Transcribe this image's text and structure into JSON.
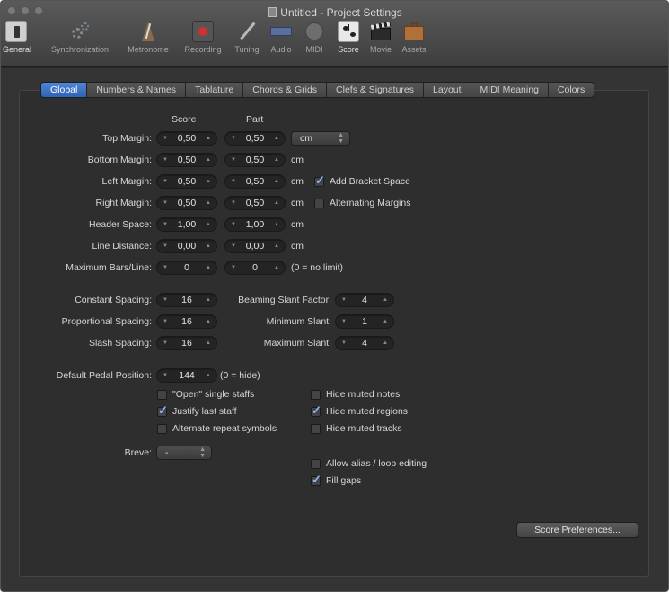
{
  "window": {
    "title": "Untitled - Project Settings"
  },
  "toolbar": [
    {
      "label": "General",
      "icon": "general-icon",
      "color": "#cfcfcf"
    },
    {
      "label": "Synchronization",
      "icon": "synchronization-icon",
      "color": "#7d8b97"
    },
    {
      "label": "Metronome",
      "icon": "metronome-icon",
      "color": "#8a6a4a"
    },
    {
      "label": "Recording",
      "icon": "recording-icon",
      "color": "#c03030"
    },
    {
      "label": "Tuning",
      "icon": "tuning-fork-icon",
      "color": "#b8b8b8"
    },
    {
      "label": "Audio",
      "icon": "audio-icon",
      "color": "#5a6f9a"
    },
    {
      "label": "MIDI",
      "icon": "midi-icon",
      "color": "#777777"
    },
    {
      "label": "Score",
      "icon": "score-icon",
      "color": "#e8e8e8"
    },
    {
      "label": "Movie",
      "icon": "movie-icon",
      "color": "#3a3a3a"
    },
    {
      "label": "Assets",
      "icon": "assets-icon",
      "color": "#b0703a"
    }
  ],
  "tabs": [
    "Global",
    "Numbers & Names",
    "Tablature",
    "Chords & Grids",
    "Clefs & Signatures",
    "Layout",
    "MIDI Meaning",
    "Colors"
  ],
  "columns": {
    "score": "Score",
    "part": "Part"
  },
  "margins": {
    "top": {
      "label": "Top Margin:",
      "score": "0,50",
      "part": "0,50"
    },
    "bottom": {
      "label": "Bottom Margin:",
      "score": "0,50",
      "part": "0,50",
      "unit": "cm"
    },
    "left": {
      "label": "Left Margin:",
      "score": "0,50",
      "part": "0,50",
      "unit": "cm"
    },
    "right": {
      "label": "Right Margin:",
      "score": "0,50",
      "part": "0,50",
      "unit": "cm"
    },
    "header": {
      "label": "Header Space:",
      "score": "1,00",
      "part": "1,00",
      "unit": "cm"
    },
    "line": {
      "label": "Line Distance:",
      "score": "0,00",
      "part": "0,00",
      "unit": "cm"
    },
    "maxbars": {
      "label": "Maximum Bars/Line:",
      "score": "0",
      "part": "0",
      "note": "(0 = no limit)"
    }
  },
  "unit_popup": "cm",
  "add_bracket_space": {
    "label": "Add Bracket Space",
    "checked": true
  },
  "alternating_margins": {
    "label": "Alternating Margins",
    "checked": false
  },
  "spacing": {
    "constant": {
      "label": "Constant Spacing:",
      "value": "16"
    },
    "proportional": {
      "label": "Proportional Spacing:",
      "value": "16"
    },
    "slash": {
      "label": "Slash Spacing:",
      "value": "16"
    }
  },
  "beaming": {
    "factor": {
      "label": "Beaming Slant Factor:",
      "value": "4"
    },
    "min": {
      "label": "Minimum Slant:",
      "value": "1"
    },
    "max": {
      "label": "Maximum Slant:",
      "value": "4"
    }
  },
  "pedal": {
    "label": "Default Pedal Position:",
    "value": "144",
    "note": "(0 = hide)"
  },
  "checks": {
    "open_single": {
      "label": "\"Open\" single staffs",
      "checked": false
    },
    "justify_last": {
      "label": "Justify last staff",
      "checked": true
    },
    "alt_repeat": {
      "label": "Alternate repeat symbols",
      "checked": false
    },
    "hide_notes": {
      "label": "Hide muted notes",
      "checked": false
    },
    "hide_regions": {
      "label": "Hide muted regions",
      "checked": true
    },
    "hide_tracks": {
      "label": "Hide muted tracks",
      "checked": false
    },
    "alias_loop": {
      "label": "Allow alias / loop editing",
      "checked": false
    },
    "fill_gaps": {
      "label": "Fill gaps",
      "checked": true
    }
  },
  "breve": {
    "label": "Breve:",
    "value": "-"
  },
  "score_prefs_button": "Score Preferences..."
}
